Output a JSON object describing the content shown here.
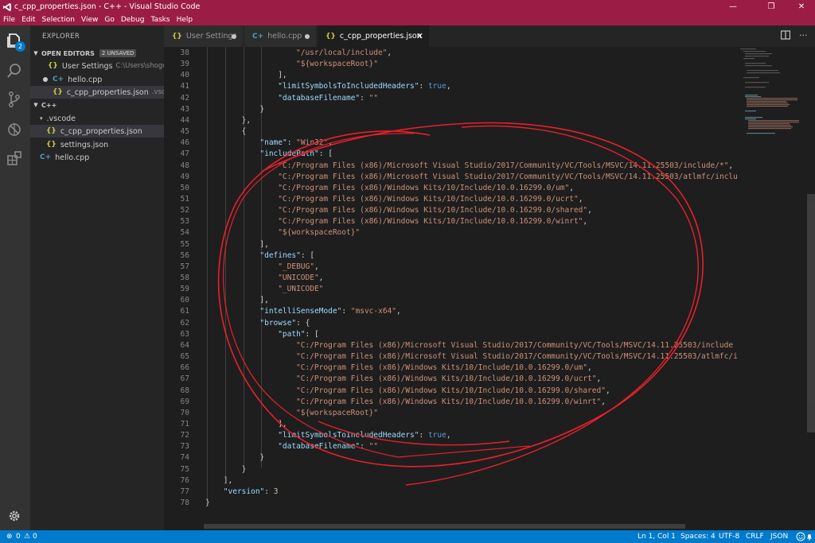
{
  "window": {
    "title": "c_cpp_properties.json - C++ - Visual Studio Code",
    "controls": {
      "minimize": "—",
      "restore": "❐",
      "close": "✕"
    }
  },
  "menu": [
    "File",
    "Edit",
    "Selection",
    "View",
    "Go",
    "Debug",
    "Tasks",
    "Help"
  ],
  "activity_bar": {
    "explorer_badge": "2"
  },
  "sidebar": {
    "title": "EXPLORER",
    "open_editors": {
      "label": "OPEN EDITORS",
      "badge": "2 UNSAVED",
      "items": [
        {
          "label": "User Settings",
          "path": "C:\\Users\\shogo...",
          "type": "json"
        },
        {
          "label": "hello.cpp",
          "path": "",
          "type": "cpp"
        },
        {
          "label": "c_cpp_properties.json",
          "path": ".vscode",
          "type": "json"
        }
      ]
    },
    "workspace": {
      "label": "C++",
      "items": [
        {
          "label": ".vscode"
        },
        {
          "label": "c_cpp_properties.json",
          "type": "json"
        },
        {
          "label": "settings.json",
          "type": "json"
        },
        {
          "label": "hello.cpp",
          "type": "cpp"
        }
      ]
    }
  },
  "tabs": [
    {
      "label": "User Settings",
      "type": "json"
    },
    {
      "label": "hello.cpp",
      "type": "cpp"
    },
    {
      "label": "c_cpp_properties.json",
      "type": "json"
    }
  ],
  "editor": {
    "lines": [
      {
        "no": "38",
        "indent": 5,
        "parts": [
          [
            "s",
            "\"/usr/local/include\""
          ],
          [
            "p",
            ","
          ]
        ]
      },
      {
        "no": "39",
        "indent": 5,
        "parts": [
          [
            "s",
            "\"${workspaceRoot}\""
          ]
        ]
      },
      {
        "no": "40",
        "indent": 4,
        "parts": [
          [
            "p",
            "],"
          ]
        ]
      },
      {
        "no": "41",
        "indent": 4,
        "parts": [
          [
            "k",
            "\"limitSymbolsToIncludedHeaders\""
          ],
          [
            "p",
            ": "
          ],
          [
            "b",
            "true"
          ],
          [
            "p",
            ","
          ]
        ]
      },
      {
        "no": "42",
        "indent": 4,
        "parts": [
          [
            "k",
            "\"databaseFilename\""
          ],
          [
            "p",
            ": "
          ],
          [
            "s",
            "\"\""
          ]
        ]
      },
      {
        "no": "43",
        "indent": 3,
        "parts": [
          [
            "p",
            "}"
          ]
        ]
      },
      {
        "no": "44",
        "indent": 2,
        "parts": [
          [
            "p",
            "},"
          ]
        ]
      },
      {
        "no": "45",
        "indent": 2,
        "parts": [
          [
            "p",
            "{"
          ]
        ]
      },
      {
        "no": "46",
        "indent": 3,
        "parts": [
          [
            "k",
            "\"name\""
          ],
          [
            "p",
            ": "
          ],
          [
            "s",
            "\"Win32\""
          ],
          [
            "p",
            ","
          ]
        ]
      },
      {
        "no": "47",
        "indent": 3,
        "parts": [
          [
            "k",
            "\"includePath\""
          ],
          [
            "p",
            ": ["
          ]
        ]
      },
      {
        "no": "48",
        "indent": 4,
        "parts": [
          [
            "s",
            "\"C:/Program Files (x86)/Microsoft Visual Studio/2017/Community/VC/Tools/MSVC/14.11.25503/include/*\""
          ],
          [
            "p",
            ","
          ]
        ]
      },
      {
        "no": "49",
        "indent": 4,
        "parts": [
          [
            "s",
            "\"C:/Program Files (x86)/Microsoft Visual Studio/2017/Community/VC/Tools/MSVC/14.11.25503/atlmfc/inclu"
          ]
        ]
      },
      {
        "no": "50",
        "indent": 4,
        "parts": [
          [
            "s",
            "\"C:/Program Files (x86)/Windows Kits/10/Include/10.0.16299.0/um\""
          ],
          [
            "p",
            ","
          ]
        ]
      },
      {
        "no": "51",
        "indent": 4,
        "parts": [
          [
            "s",
            "\"C:/Program Files (x86)/Windows Kits/10/Include/10.0.16299.0/ucrt\""
          ],
          [
            "p",
            ","
          ]
        ]
      },
      {
        "no": "52",
        "indent": 4,
        "parts": [
          [
            "s",
            "\"C:/Program Files (x86)/Windows Kits/10/Include/10.0.16299.0/shared\""
          ],
          [
            "p",
            ","
          ]
        ]
      },
      {
        "no": "53",
        "indent": 4,
        "parts": [
          [
            "s",
            "\"C:/Program Files (x86)/Windows Kits/10/Include/10.0.16299.0/winrt\""
          ],
          [
            "p",
            ","
          ]
        ]
      },
      {
        "no": "54",
        "indent": 4,
        "parts": [
          [
            "s",
            "\"${workspaceRoot}\""
          ]
        ]
      },
      {
        "no": "55",
        "indent": 3,
        "parts": [
          [
            "p",
            "],"
          ]
        ]
      },
      {
        "no": "56",
        "indent": 3,
        "parts": [
          [
            "k",
            "\"defines\""
          ],
          [
            "p",
            ": ["
          ]
        ]
      },
      {
        "no": "57",
        "indent": 4,
        "parts": [
          [
            "s",
            "\"_DEBUG\""
          ],
          [
            "p",
            ","
          ]
        ]
      },
      {
        "no": "58",
        "indent": 4,
        "parts": [
          [
            "s",
            "\"UNICODE\""
          ],
          [
            "p",
            ","
          ]
        ]
      },
      {
        "no": "59",
        "indent": 4,
        "parts": [
          [
            "s",
            "\"_UNICODE\""
          ]
        ]
      },
      {
        "no": "60",
        "indent": 3,
        "parts": [
          [
            "p",
            "],"
          ]
        ]
      },
      {
        "no": "61",
        "indent": 3,
        "parts": [
          [
            "k",
            "\"intelliSenseMode\""
          ],
          [
            "p",
            ": "
          ],
          [
            "s",
            "\"msvc-x64\""
          ],
          [
            "p",
            ","
          ]
        ]
      },
      {
        "no": "62",
        "indent": 3,
        "parts": [
          [
            "k",
            "\"browse\""
          ],
          [
            "p",
            ": {"
          ]
        ]
      },
      {
        "no": "63",
        "indent": 4,
        "parts": [
          [
            "k",
            "\"path\""
          ],
          [
            "p",
            ": ["
          ]
        ]
      },
      {
        "no": "64",
        "indent": 5,
        "parts": [
          [
            "s",
            "\"C:/Program Files (x86)/Microsoft Visual Studio/2017/Community/VC/Tools/MSVC/14.11.25503/include"
          ]
        ]
      },
      {
        "no": "65",
        "indent": 5,
        "parts": [
          [
            "s",
            "\"C:/Program Files (x86)/Microsoft Visual Studio/2017/Community/VC/Tools/MSVC/14.11.25503/atlmfc/i"
          ]
        ]
      },
      {
        "no": "66",
        "indent": 5,
        "parts": [
          [
            "s",
            "\"C:/Program Files (x86)/Windows Kits/10/Include/10.0.16299.0/um\""
          ],
          [
            "p",
            ","
          ]
        ]
      },
      {
        "no": "67",
        "indent": 5,
        "parts": [
          [
            "s",
            "\"C:/Program Files (x86)/Windows Kits/10/Include/10.0.16299.0/ucrt\""
          ],
          [
            "p",
            ","
          ]
        ]
      },
      {
        "no": "68",
        "indent": 5,
        "parts": [
          [
            "s",
            "\"C:/Program Files (x86)/Windows Kits/10/Include/10.0.16299.0/shared\""
          ],
          [
            "p",
            ","
          ]
        ]
      },
      {
        "no": "69",
        "indent": 5,
        "parts": [
          [
            "s",
            "\"C:/Program Files (x86)/Windows Kits/10/Include/10.0.16299.0/winrt\""
          ],
          [
            "p",
            ","
          ]
        ]
      },
      {
        "no": "70",
        "indent": 5,
        "parts": [
          [
            "s",
            "\"${workspaceRoot}\""
          ]
        ]
      },
      {
        "no": "71",
        "indent": 4,
        "parts": [
          [
            "p",
            "],"
          ]
        ]
      },
      {
        "no": "72",
        "indent": 4,
        "parts": [
          [
            "k",
            "\"limitSymbolsToIncludedHeaders\""
          ],
          [
            "p",
            ": "
          ],
          [
            "b",
            "true"
          ],
          [
            "p",
            ","
          ]
        ]
      },
      {
        "no": "73",
        "indent": 4,
        "parts": [
          [
            "k",
            "\"databaseFilename\""
          ],
          [
            "p",
            ": "
          ],
          [
            "s",
            "\"\""
          ]
        ]
      },
      {
        "no": "74",
        "indent": 3,
        "parts": [
          [
            "p",
            "}"
          ]
        ]
      },
      {
        "no": "75",
        "indent": 2,
        "parts": [
          [
            "p",
            "}"
          ]
        ]
      },
      {
        "no": "76",
        "indent": 1,
        "parts": [
          [
            "p",
            "],"
          ]
        ]
      },
      {
        "no": "77",
        "indent": 1,
        "parts": [
          [
            "k",
            "\"version\""
          ],
          [
            "p",
            ": "
          ],
          [
            "n",
            "3"
          ]
        ]
      },
      {
        "no": "78",
        "indent": 0,
        "parts": [
          [
            "p",
            "}"
          ]
        ]
      }
    ]
  },
  "statusbar": {
    "errors": "0",
    "warnings": "0",
    "position": "Ln 1, Col 1",
    "spaces": "Spaces: 4",
    "encoding": "UTF-8",
    "eol": "CRLF",
    "language": "JSON"
  },
  "colors": {
    "titlebar": "#9b1d45",
    "statusbar": "#007acc",
    "annotation": "#e8202a"
  }
}
